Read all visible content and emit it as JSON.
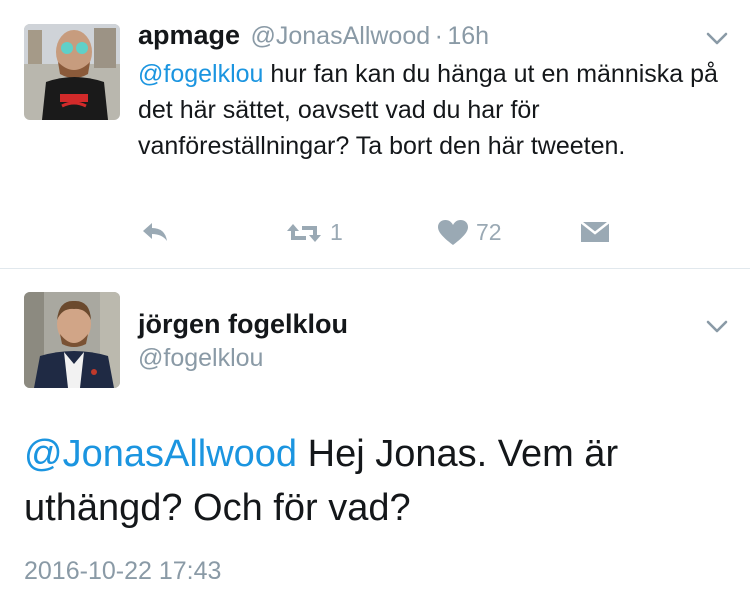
{
  "tweet1": {
    "display_name": "apmage",
    "handle": "@JonasAllwood",
    "separator": "·",
    "time": "16h",
    "mention": "@fogelklou",
    "text": " hur fan kan du hänga ut en människa på det här sättet, oavsett vad du har för vanföreställningar? Ta bort den här tweeten.",
    "retweets": "1",
    "likes": "72"
  },
  "tweet2": {
    "display_name": "jörgen fogelklou",
    "handle": "@fogelklou",
    "mention": "@JonasAllwood",
    "text": " Hej Jonas. Vem är uthängd? Och för vad?",
    "timestamp": "2016-10-22 17:43"
  },
  "icons": [
    "chevron-down-icon",
    "reply-icon",
    "retweet-icon",
    "heart-icon",
    "direct-message-icon"
  ],
  "colors": {
    "link": "#1b95e0",
    "secondary": "#8a9aa6",
    "icon": "#9aa9b4"
  }
}
